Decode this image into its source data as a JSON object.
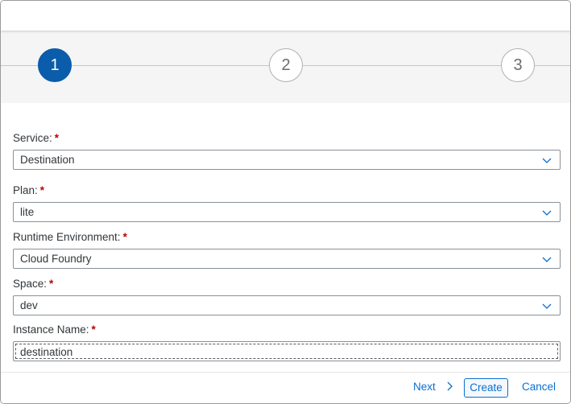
{
  "steps": [
    {
      "label": "1",
      "state": "active"
    },
    {
      "label": "2",
      "state": "inactive"
    },
    {
      "label": "3",
      "state": "inactive"
    }
  ],
  "form": {
    "service": {
      "label": "Service:",
      "required_mark": "*",
      "value": "Destination"
    },
    "plan": {
      "label": "Plan:",
      "required_mark": "*",
      "value": "lite"
    },
    "runtime": {
      "label": "Runtime Environment:",
      "required_mark": "*",
      "value": "Cloud Foundry"
    },
    "space": {
      "label": "Space:",
      "required_mark": "*",
      "value": "dev"
    },
    "instance_name": {
      "label": "Instance Name:",
      "required_mark": "*",
      "value": "destination"
    }
  },
  "footer": {
    "next_label": "Next",
    "create_label": "Create",
    "cancel_label": "Cancel"
  },
  "colors": {
    "accent": "#0a6ed1",
    "step_active": "#0b5caa",
    "required": "#bb0000"
  },
  "icons": {
    "dropdown": "chevron-down-icon",
    "next": "chevron-right-icon"
  }
}
